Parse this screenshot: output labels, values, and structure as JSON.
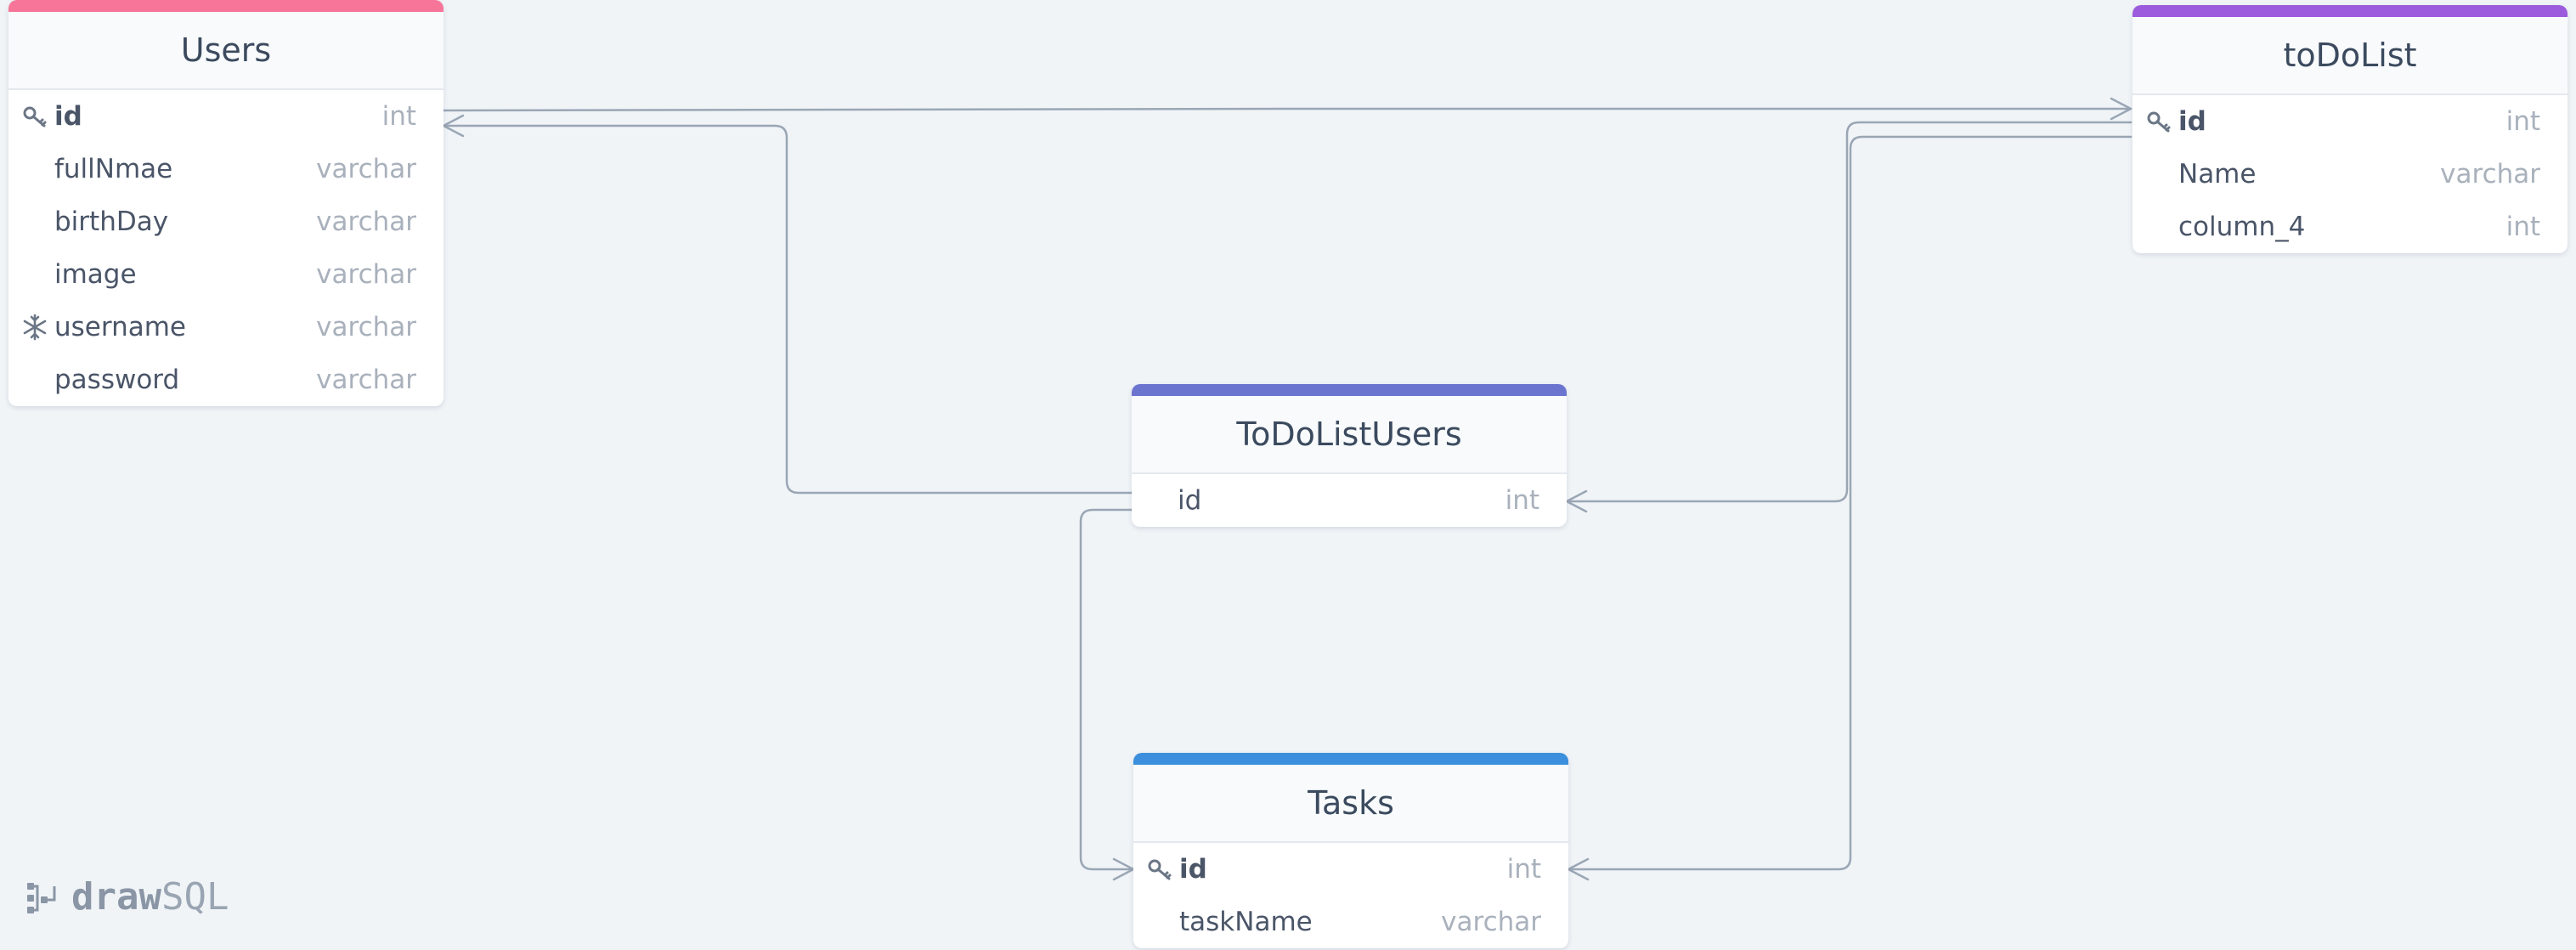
{
  "app": {
    "logo_bold": "draw",
    "logo_light": "SQL"
  },
  "colors": {
    "users": "#f67598",
    "todolist": "#9b5bdc",
    "todolistusers": "#6b74cf",
    "tasks": "#3b8fdc",
    "relation_line": "#9aa6b5"
  },
  "tables": {
    "users": {
      "title": "Users",
      "columns": [
        {
          "name": "id",
          "type": "int",
          "icon": "key-icon"
        },
        {
          "name": "fullNmae",
          "type": "varchar"
        },
        {
          "name": "birthDay",
          "type": "varchar"
        },
        {
          "name": "image",
          "type": "varchar"
        },
        {
          "name": "username",
          "type": "varchar",
          "icon": "snowflake-icon"
        },
        {
          "name": "password",
          "type": "varchar"
        }
      ]
    },
    "todolist": {
      "title": "toDoList",
      "columns": [
        {
          "name": "id",
          "type": "int",
          "icon": "key-icon"
        },
        {
          "name": "Name",
          "type": "varchar"
        },
        {
          "name": "column_4",
          "type": "int"
        }
      ]
    },
    "todolistusers": {
      "title": "ToDoListUsers",
      "columns": [
        {
          "name": "id",
          "type": "int"
        }
      ]
    },
    "tasks": {
      "title": "Tasks",
      "columns": [
        {
          "name": "id",
          "type": "int",
          "icon": "key-icon"
        },
        {
          "name": "taskName",
          "type": "varchar"
        }
      ]
    }
  }
}
